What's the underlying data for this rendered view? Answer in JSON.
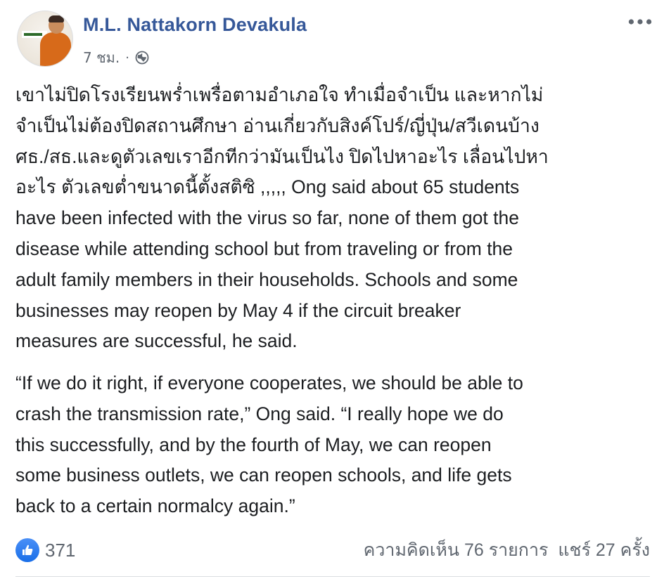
{
  "post": {
    "author": "M.L. Nattakorn Devakula",
    "time": "7 ชม.",
    "separator": "·",
    "paragraph1": [
      "เขาไม่ปิดโรงเรียนพร่ำเพรื่อตามอำเภอใจ ทำเมื่อจำเป็น และหากไม่",
      "จำเป็นไม่ต้องปิดสถานศึกษา อ่านเกี่ยวกับสิงค์โปร์/ญี่ปุ่น/สวีเดนบ้าง",
      "ศธ./สธ.และดูตัวเลขเราอีกทีกว่ามันเป็นไง ปิดไปหาอะไร เลื่อนไปหา",
      "อะไร ตัวเลขต่ำขนาดนี้ตั้งสติซิ ,,,,, Ong said about 65 students",
      "have been infected with the virus so far, none of them got the",
      "disease while attending school but from traveling or from the",
      "adult family members in their households. Schools and some",
      "businesses may reopen by May 4 if the circuit breaker",
      "measures are successful, he said."
    ],
    "paragraph2": [
      "“If we do it right, if everyone cooperates, we should be able to",
      "crash the transmission rate,” Ong said. “I really hope we do",
      "this successfully, and by the fourth of May, we can reopen",
      "some business outlets, we can reopen schools, and life gets",
      "back to a certain normalcy again.”"
    ],
    "reactions": {
      "like_count": "371",
      "icon": "thumbs-up-icon",
      "color": "#1877f2"
    },
    "comments": "ความคิดเห็น 76 รายการ",
    "shares": "แชร์ 27 ครั้ง"
  },
  "colors": {
    "author": "#365899",
    "meta": "#606770",
    "text": "#1c1e21"
  }
}
